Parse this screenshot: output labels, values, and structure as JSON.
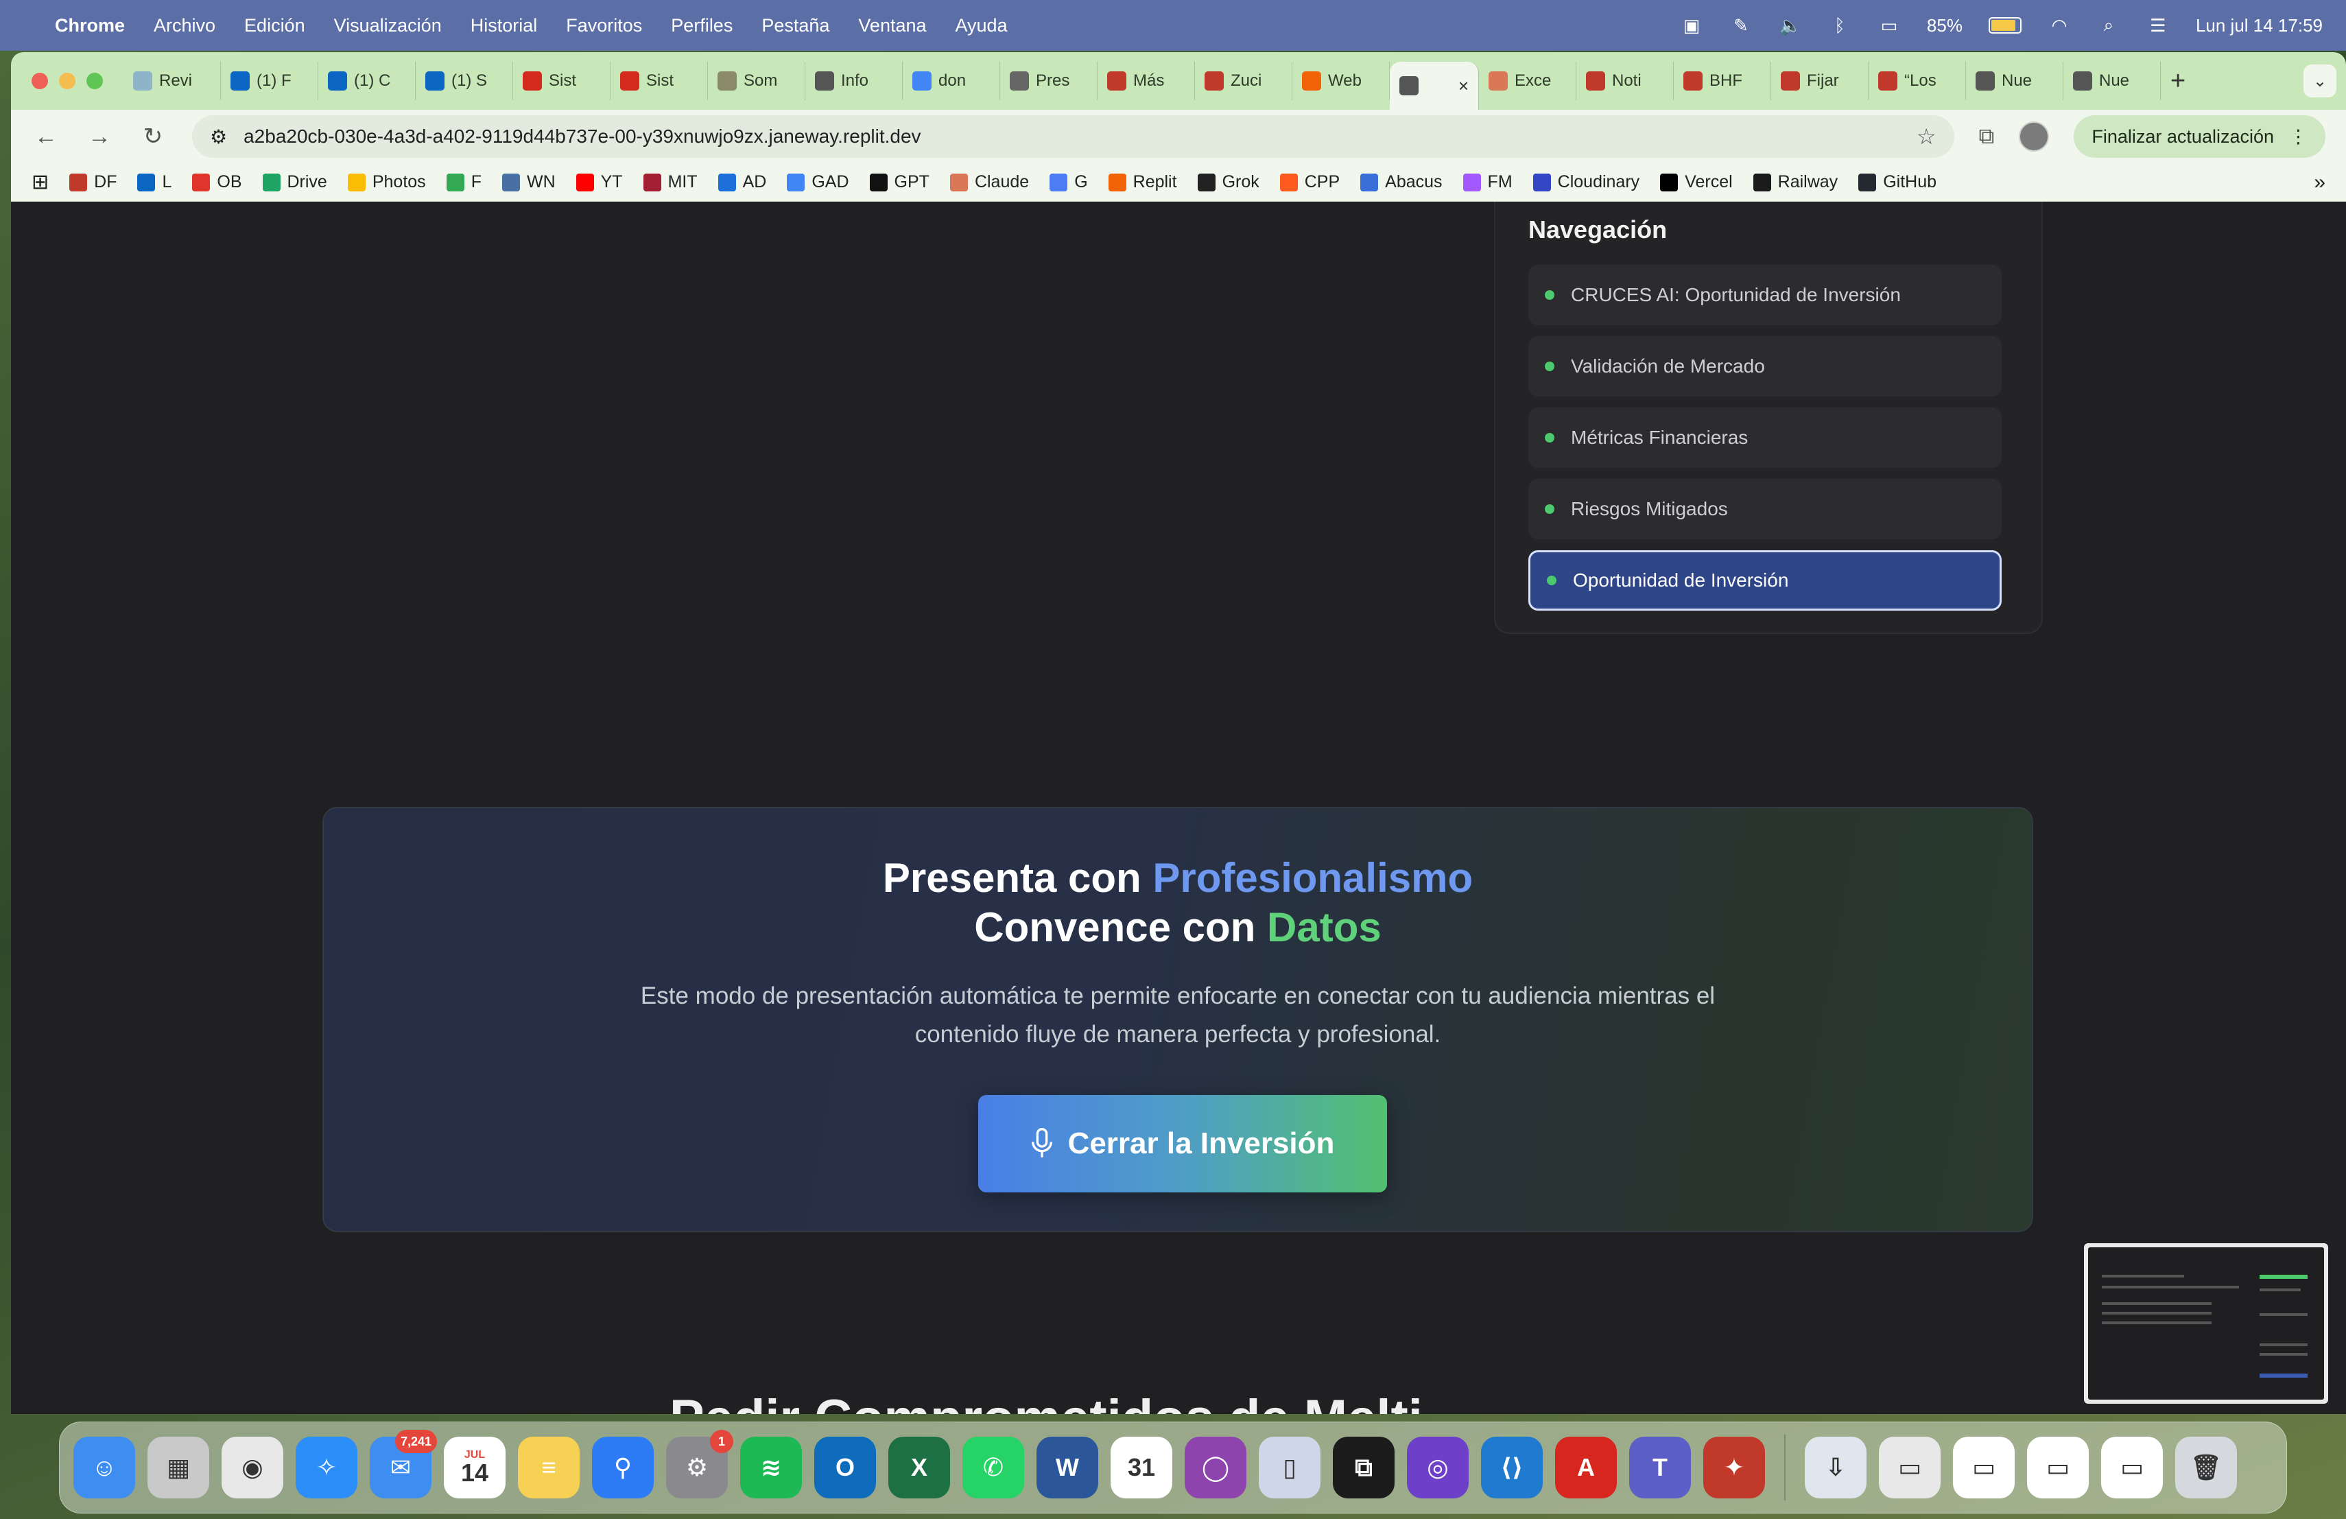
{
  "menubar": {
    "app_name": "Chrome",
    "items": [
      "Archivo",
      "Edición",
      "Visualización",
      "Historial",
      "Favoritos",
      "Perfiles",
      "Pestaña",
      "Ventana",
      "Ayuda"
    ],
    "battery": "85%",
    "datetime": "Lun jul 14  17:59"
  },
  "tabs": [
    {
      "label": "Revi",
      "icon": "wave-icon",
      "color": "#8fb3c9"
    },
    {
      "label": "(1) F",
      "icon": "linkedin-icon",
      "color": "#0a66c2"
    },
    {
      "label": "(1) C",
      "icon": "linkedin-icon",
      "color": "#0a66c2"
    },
    {
      "label": "(1) S",
      "icon": "linkedin-icon",
      "color": "#0a66c2"
    },
    {
      "label": "Sist",
      "icon": "flag-icon",
      "color": "#d52b1e"
    },
    {
      "label": "Sist",
      "icon": "flag-icon",
      "color": "#d52b1e"
    },
    {
      "label": "Som",
      "icon": "circle-icon",
      "color": "#8a8a6a"
    },
    {
      "label": "Info",
      "icon": "globe-icon",
      "color": "#555555"
    },
    {
      "label": "don",
      "icon": "google-icon",
      "color": "#4285f4"
    },
    {
      "label": "Pres",
      "icon": "spiral-icon",
      "color": "#666666"
    },
    {
      "label": "Más",
      "icon": "df-icon",
      "color": "#c0392b"
    },
    {
      "label": "Zuci",
      "icon": "df-icon",
      "color": "#c0392b"
    },
    {
      "label": "Web",
      "icon": "replit-icon",
      "color": "#f26207"
    },
    {
      "label": "",
      "icon": "globe-icon",
      "color": "#555555",
      "active": true
    },
    {
      "label": "Exce",
      "icon": "claude-icon",
      "color": "#d97757"
    },
    {
      "label": "Noti",
      "icon": "df-icon",
      "color": "#c0392b"
    },
    {
      "label": "BHF",
      "icon": "df-icon",
      "color": "#c0392b"
    },
    {
      "label": "Fijar",
      "icon": "df-icon",
      "color": "#c0392b"
    },
    {
      "label": "“Los",
      "icon": "df-icon",
      "color": "#c0392b"
    },
    {
      "label": "Nue",
      "icon": "chrome-icon",
      "color": "#555555"
    },
    {
      "label": "Nue",
      "icon": "chrome-icon",
      "color": "#555555"
    }
  ],
  "toolbar": {
    "url": "a2ba20cb-030e-4a3d-a402-9119d44b737e-00-y39xnuwjo9zx.janeway.replit.dev",
    "update_label": "Finalizar actualización"
  },
  "bookmarks": [
    {
      "label": "DF",
      "color": "#c0392b"
    },
    {
      "label": "L",
      "color": "#0a66c2"
    },
    {
      "label": "OB",
      "color": "#e0352b"
    },
    {
      "label": "Drive",
      "color": "#1fa463"
    },
    {
      "label": "Photos",
      "color": "#fbbc04"
    },
    {
      "label": "F",
      "color": "#34a853"
    },
    {
      "label": "WN",
      "color": "#4a6fa5"
    },
    {
      "label": "YT",
      "color": "#ff0000"
    },
    {
      "label": "MIT",
      "color": "#a31f34"
    },
    {
      "label": "AD",
      "color": "#1e6fd9"
    },
    {
      "label": "GAD",
      "color": "#4285f4"
    },
    {
      "label": "GPT",
      "color": "#111111"
    },
    {
      "label": "Claude",
      "color": "#d97757"
    },
    {
      "label": "G",
      "color": "#4e7cf6"
    },
    {
      "label": "Replit",
      "color": "#f26207"
    },
    {
      "label": "Grok",
      "color": "#222222"
    },
    {
      "label": "CPP",
      "color": "#ff5a1f"
    },
    {
      "label": "Abacus",
      "color": "#3b6fd8"
    },
    {
      "label": "FM",
      "color": "#a259ff"
    },
    {
      "label": "Cloudinary",
      "color": "#3448c5"
    },
    {
      "label": "Vercel",
      "color": "#000000"
    },
    {
      "label": "Railway",
      "color": "#1b1b1b"
    },
    {
      "label": "GitHub",
      "color": "#24292f"
    }
  ],
  "navigation": {
    "title": "Navegación",
    "items": [
      {
        "label": "CRUCES AI: Oportunidad de Inversión"
      },
      {
        "label": "Validación de Mercado"
      },
      {
        "label": "Métricas Financieras"
      },
      {
        "label": "Riesgos Mitigados"
      },
      {
        "label": "Oportunidad de Inversión",
        "active": true
      }
    ]
  },
  "cta": {
    "title_line1_plain": "Presenta con ",
    "title_line1_accent": "Profesionalismo",
    "title_line2_plain": "Convence con ",
    "title_line2_accent": "Datos",
    "description": "Este modo de presentación automática te permite enfocarte en conectar con tu audiencia mientras el contenido fluye de manera perfecta y profesional.",
    "button_label": "Cerrar la Inversión"
  },
  "next_section_heading": "Pedir Comprometidos de Melti",
  "dock": [
    {
      "name": "finder-icon",
      "color": "#3d8ef0",
      "glyph": "☺"
    },
    {
      "name": "launchpad-icon",
      "color": "#c9c9c9",
      "glyph": "▦"
    },
    {
      "name": "chrome-icon",
      "color": "#e8e8e8",
      "glyph": "◉"
    },
    {
      "name": "safari-icon",
      "color": "#2c8ef8",
      "glyph": "✧"
    },
    {
      "name": "mail-icon",
      "color": "#3d8ef0",
      "glyph": "✉",
      "badge": "7,241"
    },
    {
      "name": "calendar-icon",
      "color": "#ffffff",
      "glyph": "14",
      "top": "JUL"
    },
    {
      "name": "notes-icon",
      "color": "#f7d154",
      "glyph": "≡"
    },
    {
      "name": "keynote-icon",
      "color": "#2d7cf6",
      "glyph": "⚲"
    },
    {
      "name": "settings-icon",
      "color": "#8a8a8e",
      "glyph": "⚙",
      "badge": "1"
    },
    {
      "name": "spotify-icon",
      "color": "#1db954",
      "glyph": "≋"
    },
    {
      "name": "outlook-icon",
      "color": "#0f6cbd",
      "glyph": "O"
    },
    {
      "name": "excel-icon",
      "color": "#1d7044",
      "glyph": "X"
    },
    {
      "name": "whatsapp-icon",
      "color": "#25d366",
      "glyph": "✆"
    },
    {
      "name": "word-icon",
      "color": "#2b579a",
      "glyph": "W"
    },
    {
      "name": "calendar-31-icon",
      "color": "#ffffff",
      "glyph": "31"
    },
    {
      "name": "circle-app-icon",
      "color": "#8e44ad",
      "glyph": "◯"
    },
    {
      "name": "iphone-mirror-icon",
      "color": "#cfd6e8",
      "glyph": "▯"
    },
    {
      "name": "replit-icon",
      "color": "#1c1c1c",
      "glyph": "⧉"
    },
    {
      "name": "github-desktop-icon",
      "color": "#6e40c9",
      "glyph": "◎"
    },
    {
      "name": "vscode-icon",
      "color": "#1f7ad0",
      "glyph": "⟨⟩"
    },
    {
      "name": "acrobat-icon",
      "color": "#d7261e",
      "glyph": "A"
    },
    {
      "name": "teams-icon",
      "color": "#5b5fc7",
      "glyph": "T"
    },
    {
      "name": "photo-booth-icon",
      "color": "#c0392b",
      "glyph": "✦"
    },
    {
      "name": "downloads-icon",
      "color": "#e0e6ee",
      "glyph": "⇩"
    },
    {
      "name": "window-thumb-1-icon",
      "color": "#e8e8e8",
      "glyph": "▭"
    },
    {
      "name": "window-thumb-2-icon",
      "color": "#ffffff",
      "glyph": "▭"
    },
    {
      "name": "window-thumb-3-icon",
      "color": "#ffffff",
      "glyph": "▭"
    },
    {
      "name": "window-thumb-4-icon",
      "color": "#ffffff",
      "glyph": "▭"
    },
    {
      "name": "trash-icon",
      "color": "#d5d8dc",
      "glyph": "🗑"
    }
  ]
}
